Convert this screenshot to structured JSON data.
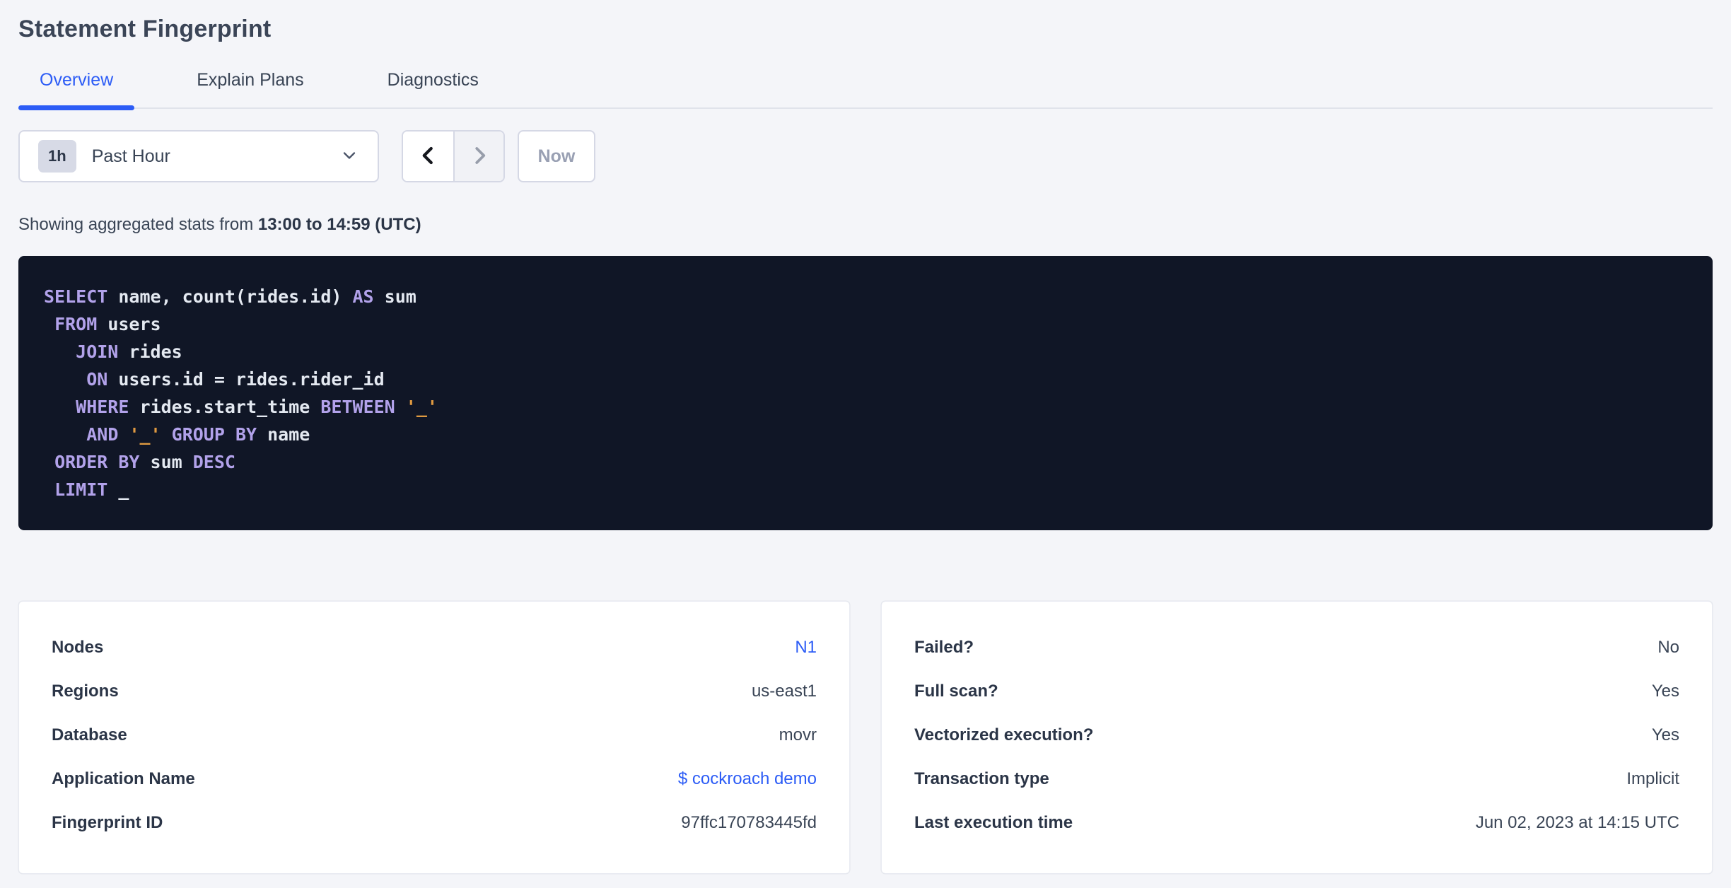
{
  "page": {
    "title": "Statement Fingerprint"
  },
  "tabs": [
    {
      "label": "Overview",
      "active": true
    },
    {
      "label": "Explain Plans",
      "active": false
    },
    {
      "label": "Diagnostics",
      "active": false
    }
  ],
  "time_picker": {
    "badge": "1h",
    "selected": "Past Hour",
    "now_label": "Now",
    "prev_enabled": true,
    "next_enabled": false,
    "icons": [
      "chevron-down-icon",
      "chevron-left-icon",
      "chevron-right-icon"
    ]
  },
  "stats_line": {
    "prefix": "Showing aggregated stats from ",
    "range": "13:00 to 14:59 (UTC)"
  },
  "sql": {
    "lines": [
      [
        {
          "t": "kw",
          "v": "SELECT"
        },
        {
          "t": "p",
          "v": " name, count(rides.id) "
        },
        {
          "t": "kw",
          "v": "AS"
        },
        {
          "t": "p",
          "v": " sum"
        }
      ],
      [
        {
          "t": "p",
          "v": " "
        },
        {
          "t": "kw",
          "v": "FROM"
        },
        {
          "t": "p",
          "v": " users"
        }
      ],
      [
        {
          "t": "p",
          "v": "   "
        },
        {
          "t": "kw",
          "v": "JOIN"
        },
        {
          "t": "p",
          "v": " rides"
        }
      ],
      [
        {
          "t": "p",
          "v": "    "
        },
        {
          "t": "kw",
          "v": "ON"
        },
        {
          "t": "p",
          "v": " users.id = rides.rider_id"
        }
      ],
      [
        {
          "t": "p",
          "v": "   "
        },
        {
          "t": "kw",
          "v": "WHERE"
        },
        {
          "t": "p",
          "v": " rides.start_time "
        },
        {
          "t": "kw",
          "v": "BETWEEN"
        },
        {
          "t": "p",
          "v": " "
        },
        {
          "t": "str",
          "v": "'_'"
        }
      ],
      [
        {
          "t": "p",
          "v": "    "
        },
        {
          "t": "kw",
          "v": "AND"
        },
        {
          "t": "p",
          "v": " "
        },
        {
          "t": "str",
          "v": "'_'"
        },
        {
          "t": "p",
          "v": " "
        },
        {
          "t": "kw",
          "v": "GROUP BY"
        },
        {
          "t": "p",
          "v": " name"
        }
      ],
      [
        {
          "t": "p",
          "v": " "
        },
        {
          "t": "kw",
          "v": "ORDER BY"
        },
        {
          "t": "p",
          "v": " sum "
        },
        {
          "t": "kw",
          "v": "DESC"
        }
      ],
      [
        {
          "t": "p",
          "v": " "
        },
        {
          "t": "kw",
          "v": "LIMIT"
        },
        {
          "t": "p",
          "v": " _"
        }
      ]
    ]
  },
  "cards": {
    "left": {
      "rows": [
        {
          "label": "Nodes",
          "value": "N1",
          "link": true
        },
        {
          "label": "Regions",
          "value": "us-east1",
          "link": false
        },
        {
          "label": "Database",
          "value": "movr",
          "link": false
        },
        {
          "label": "Application Name",
          "value": "$ cockroach demo",
          "link": true
        },
        {
          "label": "Fingerprint ID",
          "value": "97ffc170783445fd",
          "link": false
        }
      ]
    },
    "right": {
      "rows": [
        {
          "label": "Failed?",
          "value": "No",
          "link": false
        },
        {
          "label": "Full scan?",
          "value": "Yes",
          "link": false
        },
        {
          "label": "Vectorized execution?",
          "value": "Yes",
          "link": false
        },
        {
          "label": "Transaction type",
          "value": "Implicit",
          "link": false
        },
        {
          "label": "Last execution time",
          "value": "Jun 02, 2023 at 14:15 UTC",
          "link": false
        }
      ]
    }
  },
  "colors": {
    "accent_blue": "#2c5cf6",
    "page_bg": "#f4f5f9",
    "code_bg": "#101626",
    "code_keyword": "#b2a2ea",
    "code_string": "#e09a41",
    "code_text": "#e4e9f1"
  }
}
